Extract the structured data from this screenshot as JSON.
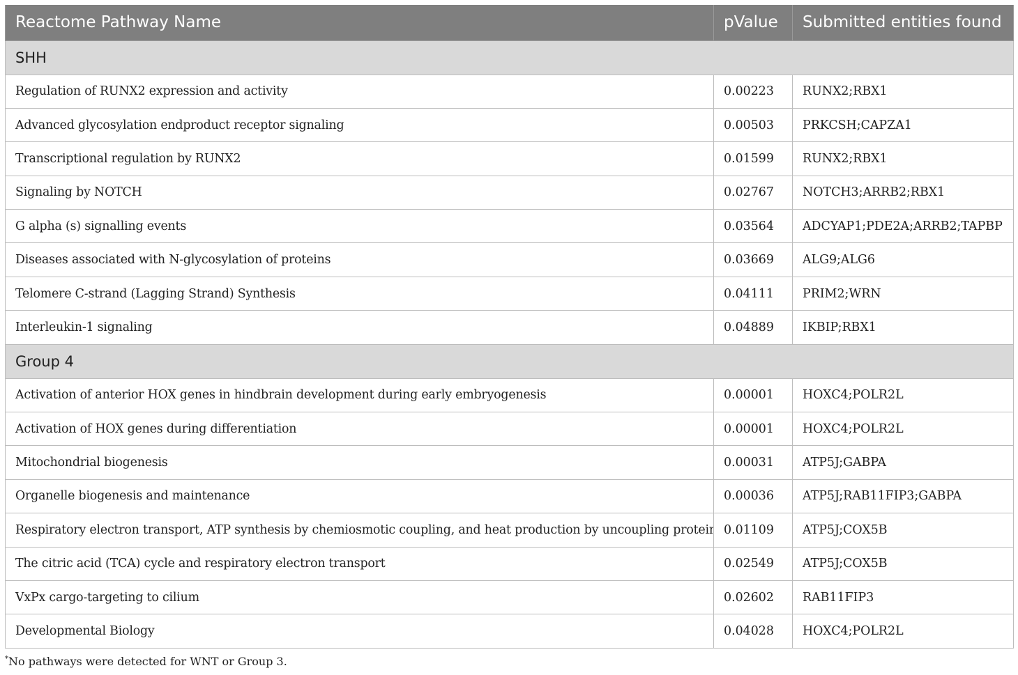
{
  "table": {
    "headers": [
      "Reactome Pathway Name",
      "pValue",
      "Submitted entities found"
    ],
    "groups": [
      {
        "label": "SHH",
        "rows": [
          [
            "Regulation of RUNX2 expression and activity",
            "0.00223",
            "RUNX2;RBX1"
          ],
          [
            "Advanced glycosylation endproduct receptor signaling",
            "0.00503",
            "PRKCSH;CAPZA1"
          ],
          [
            "Transcriptional regulation by RUNX2",
            "0.01599",
            "RUNX2;RBX1"
          ],
          [
            "Signaling by NOTCH",
            "0.02767",
            "NOTCH3;ARRB2;RBX1"
          ],
          [
            "G alpha (s) signalling events",
            "0.03564",
            "ADCYAP1;PDE2A;ARRB2;TAPBP"
          ],
          [
            "Diseases associated with N-glycosylation of proteins",
            "0.03669",
            "ALG9;ALG6"
          ],
          [
            "Telomere C-strand (Lagging Strand) Synthesis",
            "0.04111",
            "PRIM2;WRN"
          ],
          [
            "Interleukin-1 signaling",
            "0.04889",
            "IKBIP;RBX1"
          ]
        ]
      },
      {
        "label": "Group 4",
        "rows": [
          [
            "Activation of anterior HOX genes in hindbrain development during early embryogenesis",
            "0.00001",
            "HOXC4;POLR2L"
          ],
          [
            "Activation of HOX genes during differentiation",
            "0.00001",
            "HOXC4;POLR2L"
          ],
          [
            "Mitochondrial biogenesis",
            "0.00031",
            "ATP5J;GABPA"
          ],
          [
            "Organelle biogenesis and maintenance",
            "0.00036",
            "ATP5J;RAB11FIP3;GABPA"
          ],
          [
            "Respiratory electron transport, ATP synthesis by chemiosmotic coupling, and heat production by uncoupling proteins.",
            "0.01109",
            "ATP5J;COX5B"
          ],
          [
            "The citric acid (TCA) cycle and respiratory electron transport",
            "0.02549",
            "ATP5J;COX5B"
          ],
          [
            "VxPx cargo-targeting to cilium",
            "0.02602",
            "RAB11FIP3"
          ],
          [
            "Developmental Biology",
            "0.04028",
            "HOXC4;POLR2L"
          ]
        ]
      }
    ]
  },
  "footnote": {
    "marker": "*",
    "text": "No pathways were detected for WNT or Group 3."
  }
}
